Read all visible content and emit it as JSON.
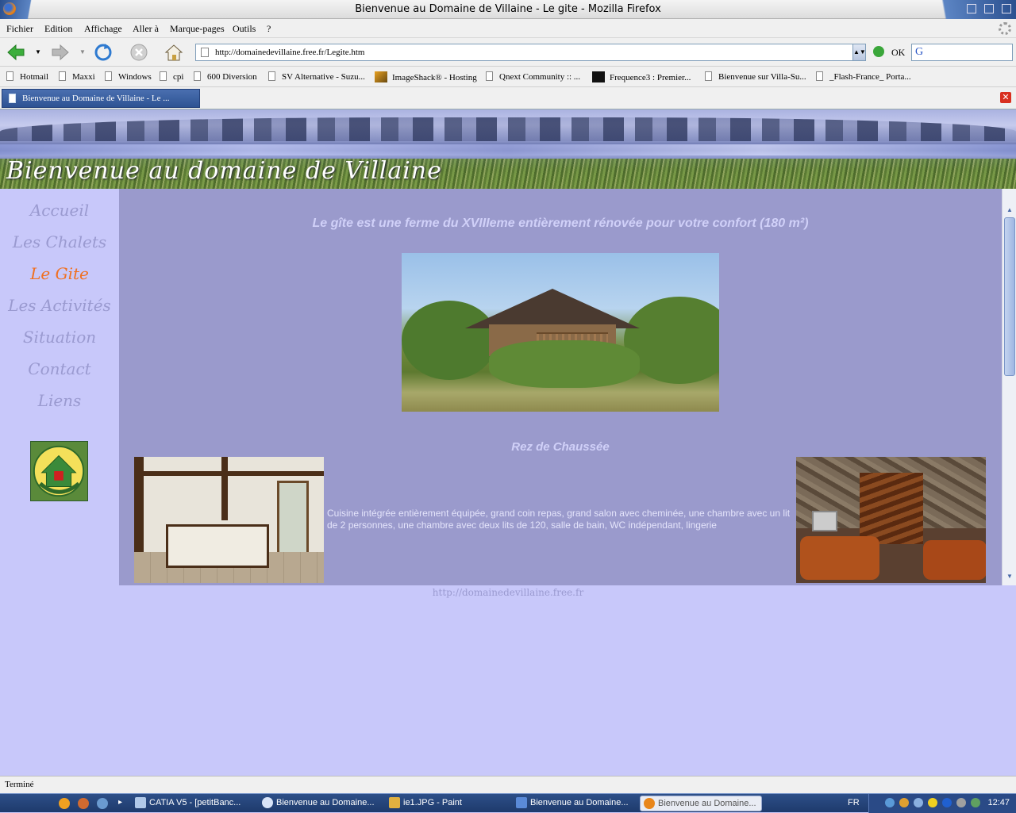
{
  "window": {
    "title": "Bienvenue au Domaine de Villaine - Le gite - Mozilla Firefox"
  },
  "menu": [
    "Fichier",
    "Edition",
    "Affichage",
    "Aller à",
    "Marque-pages",
    "Outils",
    "?"
  ],
  "navbar": {
    "url": "http://domainedevillaine.free.fr/Legite.htm",
    "go_label": "OK"
  },
  "bookmarks": [
    "Hotmail",
    "Maxxi",
    "Windows",
    "cpi",
    "600 Diversion",
    "SV Alternative - Suzu...",
    "ImageShack® - Hosting",
    "Qnext Community :: ...",
    "Frequence3 : Premier...",
    "Bienvenue sur Villa-Su...",
    "_Flash-France_ Porta..."
  ],
  "tab": {
    "label": "Bienvenue au Domaine de Villaine - Le ..."
  },
  "page": {
    "banner_title": "Bienvenue au domaine de Villaine",
    "nav": [
      "Accueil",
      "Les Chalets",
      "Le Gite",
      "Les Activités",
      "Situation",
      "Contact",
      "Liens"
    ],
    "active_nav": "Le Gite",
    "headline": "Le gîte est une ferme du XVIIIeme entièrement rénovée pour votre confort (180 m²)",
    "subhead": "Rez de Chaussée",
    "description": "Cuisine intégrée entièrement équipée, grand coin repas, grand salon avec cheminée, une chambre avec un lit de 2 personnes, une chambre avec deux lits de 120, salle de bain, WC indépendant, lingerie",
    "footer_url": "http://domainedevillaine.free.fr",
    "colors": {
      "page_bg": "#c8c8fa",
      "content_bg": "#9a9acc",
      "nav_text": "#9a9ad0",
      "nav_active": "#f07020"
    }
  },
  "status": "Terminé",
  "taskbar": {
    "items": [
      "CATIA V5 - [petitBanc...",
      "Bienvenue au Domaine...",
      "ie1.JPG - Paint",
      "Bienvenue au Domaine...",
      "Bienvenue au Domaine..."
    ],
    "lang": "FR",
    "clock": "12:47"
  }
}
